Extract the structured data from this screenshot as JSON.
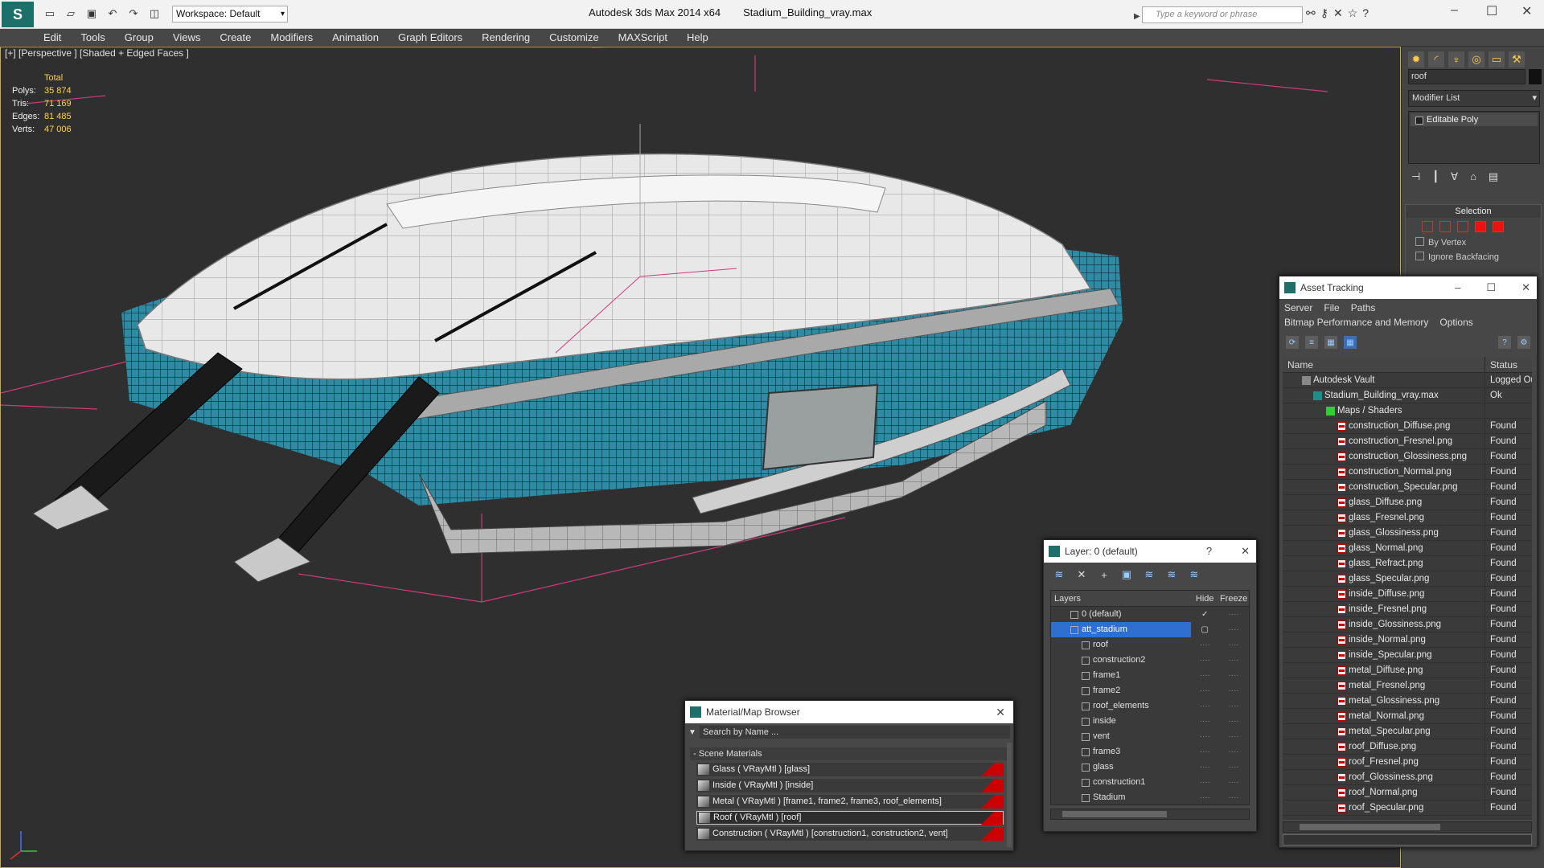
{
  "app": {
    "title": "Autodesk 3ds Max  2014 x64",
    "file": "Stadium_Building_vray.max",
    "workspace": "Workspace: Default",
    "search_placeholder": "Type a keyword or phrase"
  },
  "menu": [
    "Edit",
    "Tools",
    "Group",
    "Views",
    "Create",
    "Modifiers",
    "Animation",
    "Graph Editors",
    "Rendering",
    "Customize",
    "MAXScript",
    "Help"
  ],
  "viewport": {
    "label": "[+] [Perspective ] [Shaded + Edged Faces ]",
    "stats_header": "Total",
    "stats": [
      {
        "k": "Polys:",
        "v": "35 874"
      },
      {
        "k": "Tris:",
        "v": "71 169"
      },
      {
        "k": "Edges:",
        "v": "81 485"
      },
      {
        "k": "Verts:",
        "v": "47 006"
      }
    ],
    "accent": "#c7a94a"
  },
  "command_panel": {
    "object_name": "roof",
    "modifier_list": "Modifier List",
    "stack_item": "Editable Poly",
    "selection_title": "Selection",
    "by_vertex": "By Vertex",
    "ignore_backfacing": "Ignore Backfacing"
  },
  "asset_tracking": {
    "title": "Asset Tracking",
    "menu1": [
      "Server",
      "File",
      "Paths"
    ],
    "menu2": [
      "Bitmap Performance and Memory",
      "Options"
    ],
    "col_name": "Name",
    "col_status": "Status",
    "vault": {
      "name": "Autodesk Vault",
      "status": "Logged Ou"
    },
    "file": {
      "name": "Stadium_Building_vray.max",
      "status": "Ok"
    },
    "group": "Maps / Shaders",
    "maps": [
      {
        "name": "construction_Diffuse.png",
        "status": "Found"
      },
      {
        "name": "construction_Fresnel.png",
        "status": "Found"
      },
      {
        "name": "construction_Glossiness.png",
        "status": "Found"
      },
      {
        "name": "construction_Normal.png",
        "status": "Found"
      },
      {
        "name": "construction_Specular.png",
        "status": "Found"
      },
      {
        "name": "glass_Diffuse.png",
        "status": "Found"
      },
      {
        "name": "glass_Fresnel.png",
        "status": "Found"
      },
      {
        "name": "glass_Glossiness.png",
        "status": "Found"
      },
      {
        "name": "glass_Normal.png",
        "status": "Found"
      },
      {
        "name": "glass_Refract.png",
        "status": "Found"
      },
      {
        "name": "glass_Specular.png",
        "status": "Found"
      },
      {
        "name": "inside_Diffuse.png",
        "status": "Found"
      },
      {
        "name": "inside_Fresnel.png",
        "status": "Found"
      },
      {
        "name": "inside_Glossiness.png",
        "status": "Found"
      },
      {
        "name": "inside_Normal.png",
        "status": "Found"
      },
      {
        "name": "inside_Specular.png",
        "status": "Found"
      },
      {
        "name": "metal_Diffuse.png",
        "status": "Found"
      },
      {
        "name": "metal_Fresnel.png",
        "status": "Found"
      },
      {
        "name": "metal_Glossiness.png",
        "status": "Found"
      },
      {
        "name": "metal_Normal.png",
        "status": "Found"
      },
      {
        "name": "metal_Specular.png",
        "status": "Found"
      },
      {
        "name": "roof_Diffuse.png",
        "status": "Found"
      },
      {
        "name": "roof_Fresnel.png",
        "status": "Found"
      },
      {
        "name": "roof_Glossiness.png",
        "status": "Found"
      },
      {
        "name": "roof_Normal.png",
        "status": "Found"
      },
      {
        "name": "roof_Specular.png",
        "status": "Found"
      }
    ]
  },
  "layers": {
    "title": "Layer: 0 (default)",
    "col_layers": "Layers",
    "col_hide": "Hide",
    "col_freeze": "Freeze",
    "items": [
      {
        "name": "0 (default)",
        "level": 0
      },
      {
        "name": "att_stadium",
        "level": 0,
        "selected": true
      },
      {
        "name": "roof",
        "level": 1
      },
      {
        "name": "construction2",
        "level": 1
      },
      {
        "name": "frame1",
        "level": 1
      },
      {
        "name": "frame2",
        "level": 1
      },
      {
        "name": "roof_elements",
        "level": 1
      },
      {
        "name": "inside",
        "level": 1
      },
      {
        "name": "vent",
        "level": 1
      },
      {
        "name": "frame3",
        "level": 1
      },
      {
        "name": "glass",
        "level": 1
      },
      {
        "name": "construction1",
        "level": 1
      },
      {
        "name": "Stadium",
        "level": 1
      }
    ]
  },
  "material_browser": {
    "title": "Material/Map Browser",
    "search_placeholder": "Search by Name ...",
    "group": "Scene Materials",
    "items": [
      "Glass  ( VRayMtl ) [glass]",
      "Inside  ( VRayMtl ) [inside]",
      "Metal  ( VRayMtl ) [frame1, frame2, frame3, roof_elements]",
      "Roof  ( VRayMtl ) [roof]",
      "Construction  ( VRayMtl ) [construction1, construction2, vent]"
    ]
  }
}
